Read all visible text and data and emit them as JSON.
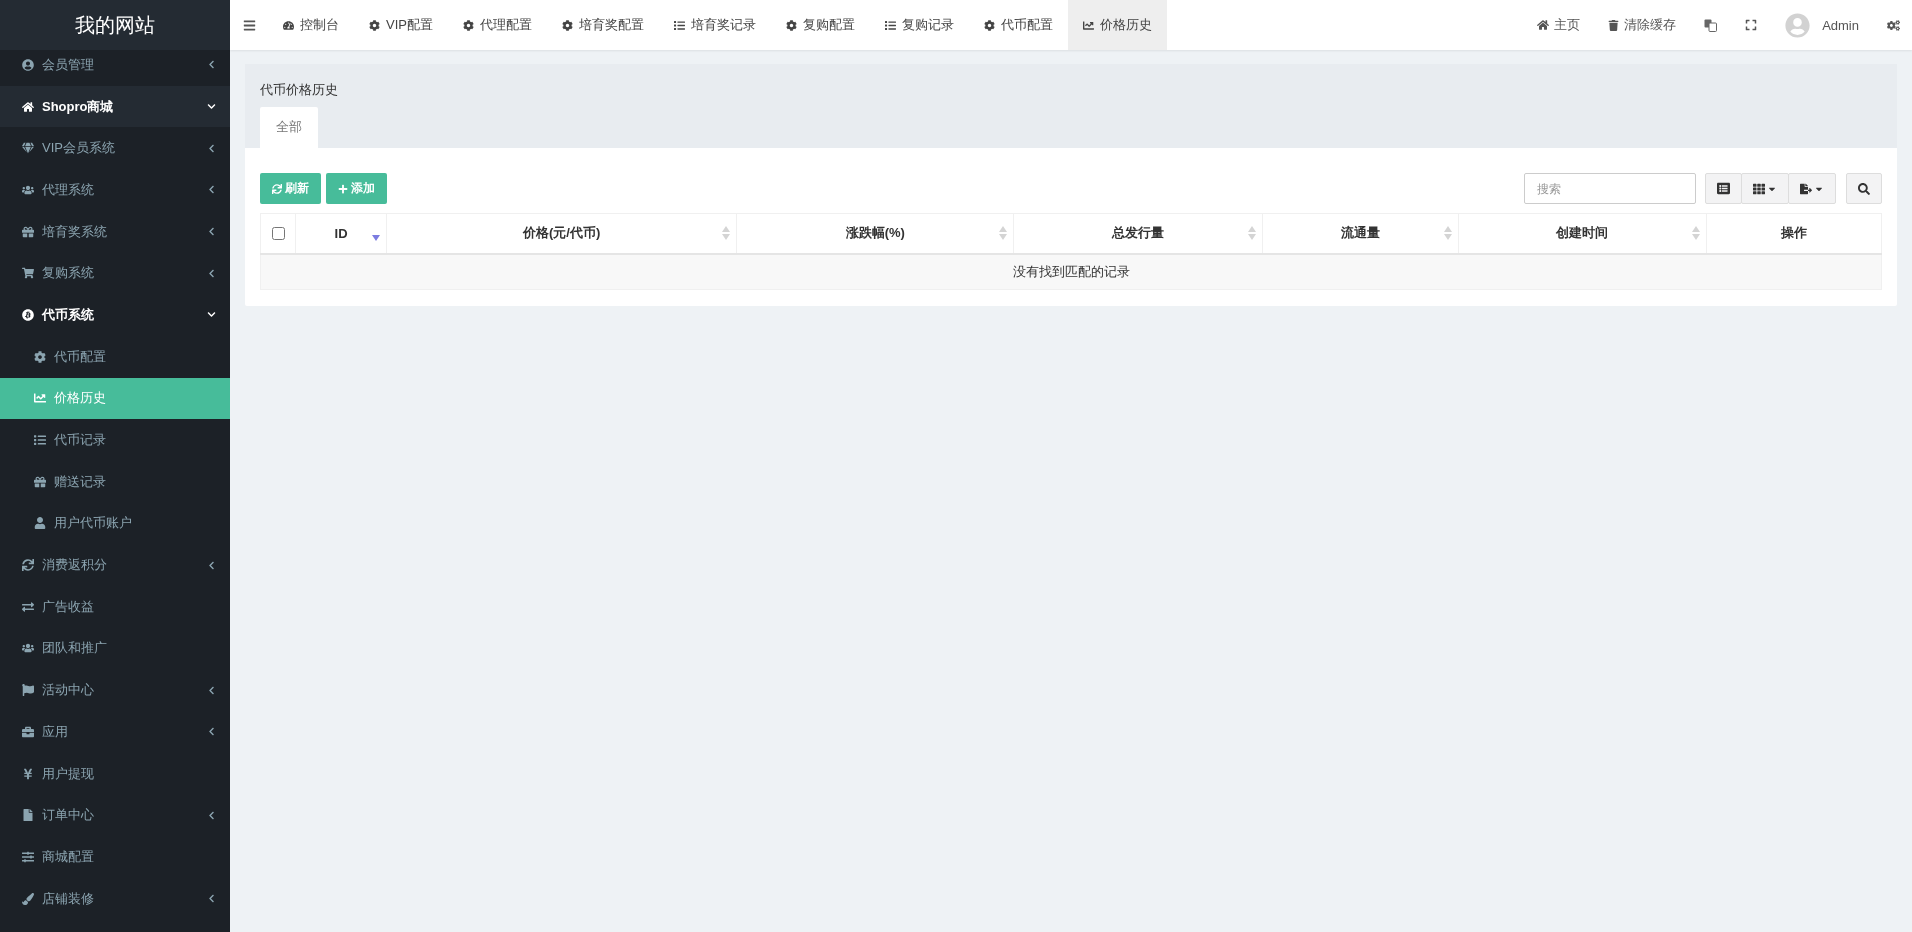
{
  "sidebar": {
    "logo": "我的网站",
    "items": [
      {
        "label": "会员管理",
        "kind": "group",
        "expanded": false,
        "selected": false
      },
      {
        "label": "Shopro商城",
        "kind": "section",
        "expanded": true,
        "selected": false
      },
      {
        "label": "VIP会员系统",
        "kind": "group",
        "expanded": false,
        "selected": false
      },
      {
        "label": "代理系统",
        "kind": "group",
        "expanded": false,
        "selected": false
      },
      {
        "label": "培育奖系统",
        "kind": "group",
        "expanded": false,
        "selected": false
      },
      {
        "label": "复购系统",
        "kind": "group",
        "expanded": false,
        "selected": false
      },
      {
        "label": "代币系统",
        "kind": "group",
        "expanded": true,
        "selected": false,
        "children": [
          {
            "label": "代币配置",
            "selected": false
          },
          {
            "label": "价格历史",
            "selected": true
          },
          {
            "label": "代币记录",
            "selected": false
          },
          {
            "label": "赠送记录",
            "selected": false
          },
          {
            "label": "用户代币账户",
            "selected": false
          }
        ]
      },
      {
        "label": "消费返积分",
        "kind": "group",
        "expanded": false,
        "selected": false
      },
      {
        "label": "广告收益",
        "kind": "link",
        "selected": false
      },
      {
        "label": "团队和推广",
        "kind": "link",
        "selected": false
      },
      {
        "label": "活动中心",
        "kind": "group",
        "expanded": false,
        "selected": false
      },
      {
        "label": "应用",
        "kind": "group",
        "expanded": false,
        "selected": false
      },
      {
        "label": "用户提现",
        "kind": "link",
        "selected": false
      },
      {
        "label": "订单中心",
        "kind": "group",
        "expanded": false,
        "selected": false
      },
      {
        "label": "商城配置",
        "kind": "link",
        "selected": false
      },
      {
        "label": "店铺装修",
        "kind": "group",
        "expanded": false,
        "selected": false
      }
    ]
  },
  "topbar": {
    "tabs": [
      {
        "label": "控制台",
        "selected": false
      },
      {
        "label": "VIP配置",
        "selected": false
      },
      {
        "label": "代理配置",
        "selected": false
      },
      {
        "label": "培育奖配置",
        "selected": false
      },
      {
        "label": "培育奖记录",
        "selected": false
      },
      {
        "label": "复购配置",
        "selected": false
      },
      {
        "label": "复购记录",
        "selected": false
      },
      {
        "label": "代币配置",
        "selected": false
      },
      {
        "label": "价格历史",
        "selected": true
      }
    ],
    "home": "主页",
    "clear_cache": "清除缓存",
    "user": "Admin"
  },
  "panel": {
    "title": "代币价格历史",
    "tabs": [
      {
        "label": "全部",
        "selected": true
      }
    ],
    "buttons": [
      {
        "label": "刷新"
      },
      {
        "label": "添加"
      }
    ],
    "search": {
      "placeholder": "搜索"
    },
    "table": {
      "select_all": {
        "checked": false
      },
      "columns": [
        {
          "label": "ID",
          "sortable": true,
          "sorted_desc": true
        },
        {
          "label": "价格(元/代币)",
          "sortable": true,
          "sorted_desc": false
        },
        {
          "label": "涨跌幅(%)",
          "sortable": true,
          "sorted_desc": false
        },
        {
          "label": "总发行量",
          "sortable": true,
          "sorted_desc": false
        },
        {
          "label": "流通量",
          "sortable": true,
          "sorted_desc": false
        },
        {
          "label": "创建时间",
          "sortable": true,
          "sorted_desc": false
        },
        {
          "label": "操作",
          "sortable": false
        }
      ],
      "empty_message": "没有找到匹配的记录"
    }
  }
}
